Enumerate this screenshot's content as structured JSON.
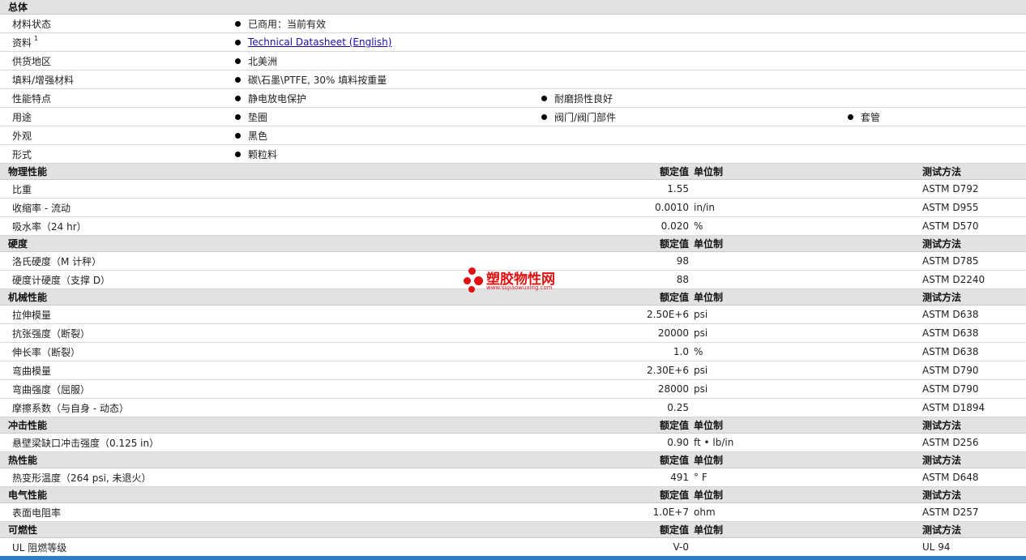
{
  "general": {
    "title": "总体",
    "rows": [
      {
        "label": "材料状态",
        "values": [
          "已商用：当前有效"
        ]
      },
      {
        "label": "资料",
        "sup": "1",
        "values": [
          "Technical Datasheet (English)"
        ],
        "link": true
      },
      {
        "label": "供货地区",
        "values": [
          "北美洲"
        ]
      },
      {
        "label": "填料/增强材料",
        "values": [
          "碳\\石墨\\PTFE, 30% 填料按重量"
        ]
      },
      {
        "label": "性能特点",
        "values": [
          "静电放电保护",
          "耐磨损性良好"
        ]
      },
      {
        "label": "用途",
        "values": [
          "垫圈",
          "阀门/阀门部件",
          "套管"
        ]
      },
      {
        "label": "外观",
        "values": [
          "黑色"
        ]
      },
      {
        "label": "形式",
        "values": [
          "颗粒料"
        ]
      }
    ]
  },
  "columns": {
    "rated": "额定值",
    "unit": "单位制",
    "test": "测试方法"
  },
  "sections": [
    {
      "title": "物理性能",
      "rows": [
        {
          "label": "比重",
          "rated": "1.55",
          "unit": "",
          "test": "ASTM D792"
        },
        {
          "label": "收缩率  - 流动",
          "rated": "0.0010",
          "unit": "in/in",
          "test": "ASTM D955"
        },
        {
          "label": "吸水率（24 hr）",
          "rated": "0.020",
          "unit": "%",
          "test": "ASTM D570"
        }
      ]
    },
    {
      "title": "硬度",
      "rows": [
        {
          "label": "洛氏硬度（M 计秤）",
          "rated": "98",
          "unit": "",
          "test": "ASTM D785"
        },
        {
          "label": "硬度计硬度（支撑  D）",
          "rated": "88",
          "unit": "",
          "test": "ASTM D2240"
        }
      ]
    },
    {
      "title": "机械性能",
      "rows": [
        {
          "label": "拉伸模量",
          "rated": "2.50E+6",
          "unit": "psi",
          "test": "ASTM D638"
        },
        {
          "label": "抗张强度（断裂）",
          "rated": "20000",
          "unit": "psi",
          "test": "ASTM D638"
        },
        {
          "label": "伸长率（断裂）",
          "rated": "1.0",
          "unit": "%",
          "test": "ASTM D638"
        },
        {
          "label": "弯曲模量",
          "rated": "2.30E+6",
          "unit": "psi",
          "test": "ASTM D790"
        },
        {
          "label": "弯曲强度（屈服）",
          "rated": "28000",
          "unit": "psi",
          "test": "ASTM D790"
        },
        {
          "label": "摩擦系数（与自身  - 动态）",
          "rated": "0.25",
          "unit": "",
          "test": "ASTM D1894"
        }
      ]
    },
    {
      "title": "冲击性能",
      "rows": [
        {
          "label": "悬壁梁缺口冲击强度（0.125 in）",
          "rated": "0.90",
          "unit": "ft • lb/in",
          "test": "ASTM D256"
        }
      ]
    },
    {
      "title": "热性能",
      "rows": [
        {
          "label": "热变形温度（264 psi, 未退火）",
          "rated": "491",
          "unit": "°  F",
          "test": "ASTM D648"
        }
      ]
    },
    {
      "title": "电气性能",
      "rows": [
        {
          "label": "表面电阻率",
          "rated": "1.0E+7",
          "unit": "ohm",
          "test": "ASTM D257"
        }
      ]
    },
    {
      "title": "可燃性",
      "rows": [
        {
          "label": "UL 阻燃等级",
          "rated": "V-0",
          "unit": "",
          "test": "UL 94"
        }
      ]
    }
  ],
  "watermark": {
    "name": "塑胶物性网",
    "url": "www.sujiaowuxing.com"
  },
  "colors": {
    "header_bg": "#e2e2e2",
    "link": "#1a0dab",
    "watermark": "#e01010",
    "bottom_bar": "#2e7bc6"
  }
}
